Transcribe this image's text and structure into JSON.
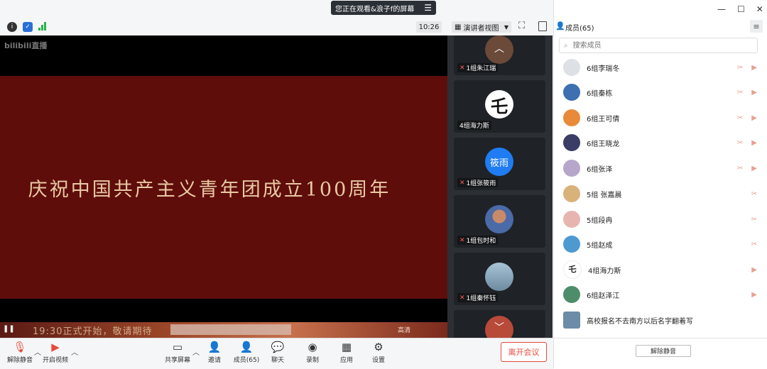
{
  "share_banner": {
    "text": "您正在观看&浪子f的屏幕",
    "menu_icon": "menu-icon"
  },
  "toolbar": {
    "time": "10:26",
    "view_label": "演讲者视图"
  },
  "video": {
    "logo_text": "bilibili直播",
    "slide_title": "庆祝中国共产主义青年团成立100周年",
    "bar_text": "19:30正式开始，敬请期待",
    "bar_right": "高清"
  },
  "thumbnails": [
    {
      "name": "1组朱江瑞",
      "muted": true,
      "avatar_color": "#6b4a3a"
    },
    {
      "name": "4组海力斯",
      "muted": false,
      "avatar_color": "#ffffff"
    },
    {
      "name": "1组张筱雨",
      "muted": true,
      "avatar_text": "筱雨",
      "avatar_color": "#1f7cf2"
    },
    {
      "name": "1组包时和",
      "muted": true,
      "avatar_color": "#4a6aa8"
    },
    {
      "name": "1组秦怀钰",
      "muted": true,
      "avatar_color": "#8aa7bd"
    },
    {
      "name": "",
      "muted": false,
      "avatar_color": "#b84a3a"
    }
  ],
  "controls": {
    "unmute": "解除静音",
    "start_video": "开启视频",
    "share_screen": "共享屏幕",
    "invite": "邀请",
    "members": "成员(65)",
    "chat": "聊天",
    "record": "录制",
    "apps": "应用",
    "settings": "设置",
    "leave": "离开会议"
  },
  "panel": {
    "title": "成员(65)",
    "search_placeholder": "搜索成员",
    "unmute_all": "解除静音",
    "members": [
      {
        "name": "6组李瑞冬",
        "color": "#9aa3ad"
      },
      {
        "name": "6组秦栋",
        "color": "#3e6fb0"
      },
      {
        "name": "6组王可倩",
        "color": "#e88a3a"
      },
      {
        "name": "6组王晓龙",
        "color": "#3b3d66"
      },
      {
        "name": "6组张泽",
        "color": "#b6a6c9"
      },
      {
        "name": "5组 张嘉晨",
        "color": "#d9b27a"
      },
      {
        "name": "5组段冉",
        "color": "#e7b5b0"
      },
      {
        "name": "5组赵成",
        "color": "#4d9ad1"
      },
      {
        "name": "4组海力斯",
        "color": "#ffffff"
      },
      {
        "name": "6组赵泽江",
        "color": "#4d8d6a"
      },
      {
        "name": "高校报名不去南方以后名字翻着写",
        "color": "#6c8ca8"
      }
    ]
  }
}
